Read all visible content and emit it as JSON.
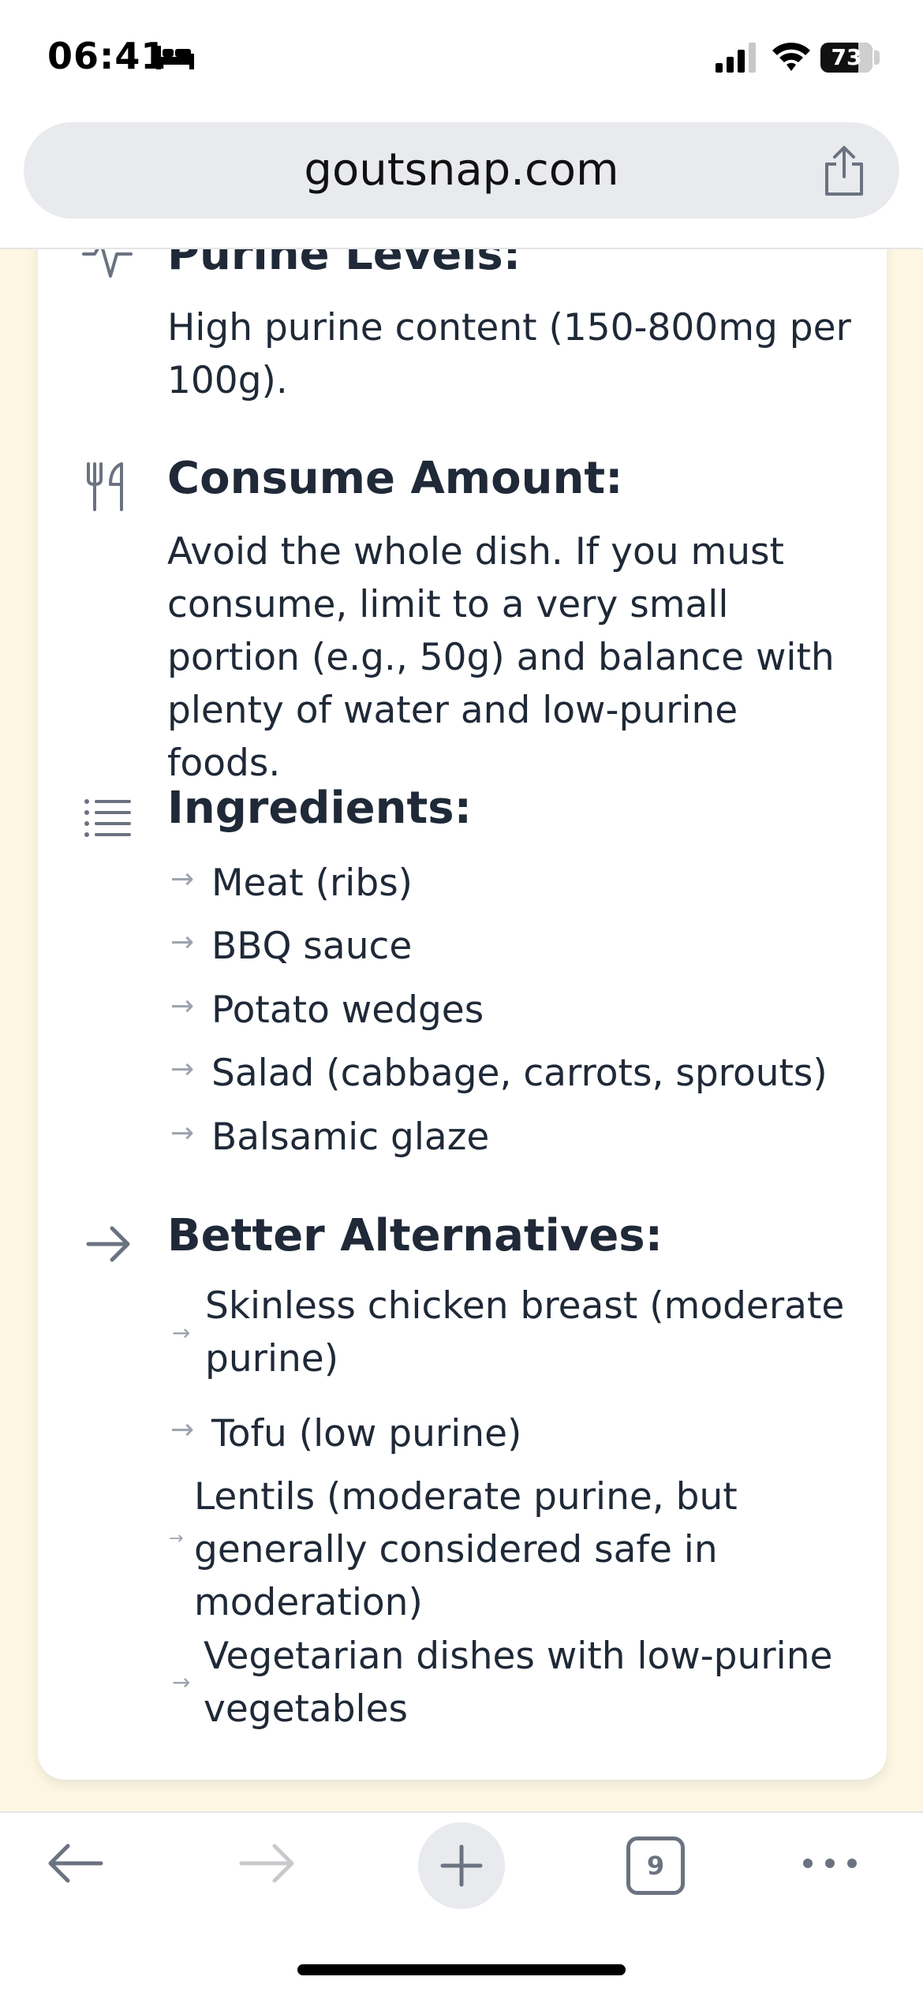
{
  "status_bar": {
    "time": "06:41",
    "battery": "73"
  },
  "browser": {
    "url": "goutsnap.com",
    "tab_count": "9"
  },
  "sections": {
    "purine": {
      "heading": "Purine Levels:",
      "text": "High purine content (150-800mg per 100g)."
    },
    "consume": {
      "heading": "Consume Amount:",
      "text": "Avoid the whole dish. If you must consume, limit to a very small portion (e.g., 50g) and balance with plenty of water and low-purine foods."
    },
    "ingredients": {
      "heading": "Ingredients:",
      "items": [
        "Meat (ribs)",
        "BBQ sauce",
        "Potato wedges",
        "Salad (cabbage, carrots, sprouts)",
        "Balsamic glaze"
      ]
    },
    "alternatives": {
      "heading": "Better Alternatives:",
      "items": [
        [
          "Skinless chicken breast (moderate",
          "purine)"
        ],
        [
          "Tofu (low purine)"
        ],
        [
          "Lentils (moderate purine, but",
          "generally considered safe in",
          "moderation)"
        ],
        [
          "Vegetarian dishes with low-purine",
          "vegetables"
        ]
      ]
    }
  },
  "icons": {
    "arrow_glyph": "→"
  }
}
